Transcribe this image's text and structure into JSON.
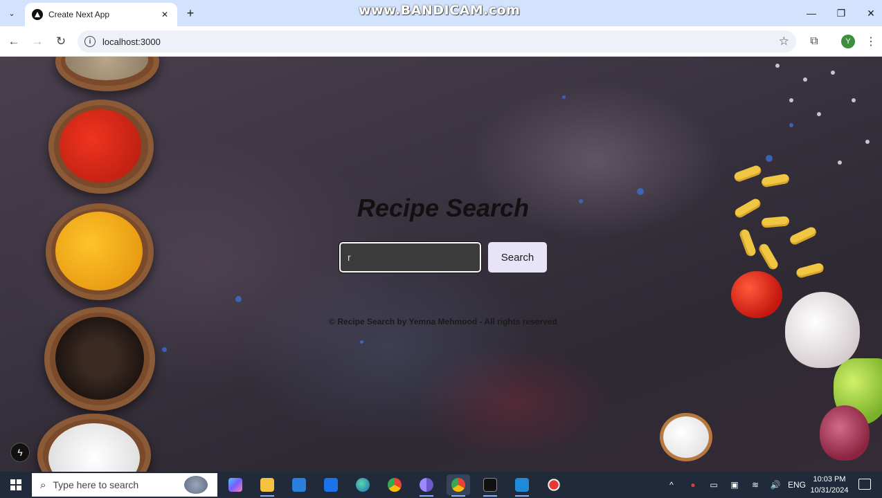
{
  "browser": {
    "tab_title": "Create Next App",
    "tab_close": "✕",
    "new_tab": "+",
    "url": "localhost:3000",
    "profile_initial": "Y",
    "watermark": "www.BANDICAM.com",
    "window_controls": {
      "minimize": "—",
      "maximize": "❐",
      "close": "✕"
    },
    "nav": {
      "back": "←",
      "forward": "→",
      "reload": "↻",
      "star": "☆",
      "extensions": "⧉",
      "menu": "⋮",
      "info": "i",
      "tab_search": "⌄"
    }
  },
  "page": {
    "title": "Recipe Search",
    "search_value": "r",
    "search_button": "Search",
    "footer": "© Recipe Search by Yemna Mehmood - All rights reserved",
    "next_badge": "ϟ"
  },
  "taskbar": {
    "search_placeholder": "Type here to search",
    "search_icon": "⌕",
    "apps": [
      {
        "name": "copilot",
        "color": "#7b5cff"
      },
      {
        "name": "file-explorer",
        "color": "#f4c141"
      },
      {
        "name": "microsoft-store",
        "color": "#2a7fdd"
      },
      {
        "name": "mail",
        "color": "#1a73e8"
      },
      {
        "name": "edge",
        "color": "#1ea67e"
      },
      {
        "name": "chrome",
        "color": "#e94335"
      },
      {
        "name": "chrome-badge",
        "color": "#6a5acd"
      },
      {
        "name": "chrome-profile",
        "color": "#34a853"
      },
      {
        "name": "terminal",
        "color": "#111111"
      },
      {
        "name": "vscode",
        "color": "#1f8ad8"
      },
      {
        "name": "bandicam",
        "color": "#e53935"
      }
    ],
    "tray": {
      "chevron": "^",
      "lang": "ENG",
      "volume": "🔊",
      "wifi": "≋",
      "battery": "▭",
      "record": "●",
      "meet": "▣"
    },
    "time": "10:03 PM",
    "date": "10/31/2024"
  },
  "colors": {
    "tabstrip": "#d3e3fd",
    "button_bg": "#e8e4f7",
    "input_bg": "#3b3b3b",
    "taskbar": "#202a3a"
  }
}
